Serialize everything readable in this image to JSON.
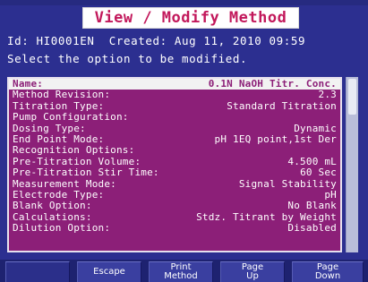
{
  "header": {
    "title": "View / Modify Method",
    "id_line": "Id: HI0001EN  Created: Aug 11, 2010 09:59",
    "prompt": "Select the option to be modified."
  },
  "options": [
    {
      "label": "Name:",
      "value": "0.1N NaOH Titr. Conc."
    },
    {
      "label": "Method Revision:",
      "value": "2.3"
    },
    {
      "label": "Titration Type:",
      "value": "Standard Titration"
    },
    {
      "label": "Pump Configuration:",
      "value": ""
    },
    {
      "label": "Dosing Type:",
      "value": "Dynamic"
    },
    {
      "label": "End Point Mode:",
      "value": "pH 1EQ point,1st Der"
    },
    {
      "label": "Recognition Options:",
      "value": ""
    },
    {
      "label": "Pre-Titration Volume:",
      "value": "4.500 mL"
    },
    {
      "label": "Pre-Titration Stir Time:",
      "value": "60 Sec"
    },
    {
      "label": "Measurement Mode:",
      "value": "Signal Stability"
    },
    {
      "label": "Electrode Type:",
      "value": "pH"
    },
    {
      "label": "Blank Option:",
      "value": "No Blank"
    },
    {
      "label": "Calculations:",
      "value": "Stdz. Titrant by Weight"
    },
    {
      "label": "Dilution Option:",
      "value": "Disabled"
    }
  ],
  "selected_index": 0,
  "softkeys": [
    {
      "line1": "",
      "line2": ""
    },
    {
      "line1": "Escape",
      "line2": ""
    },
    {
      "line1": "Print",
      "line2": "Method"
    },
    {
      "line1": "Page",
      "line2": "Up"
    },
    {
      "line1": "Page",
      "line2": "Down"
    }
  ],
  "colors": {
    "background": "#2c2f90",
    "list_background": "#8c1f78",
    "title_text": "#c2185b"
  }
}
